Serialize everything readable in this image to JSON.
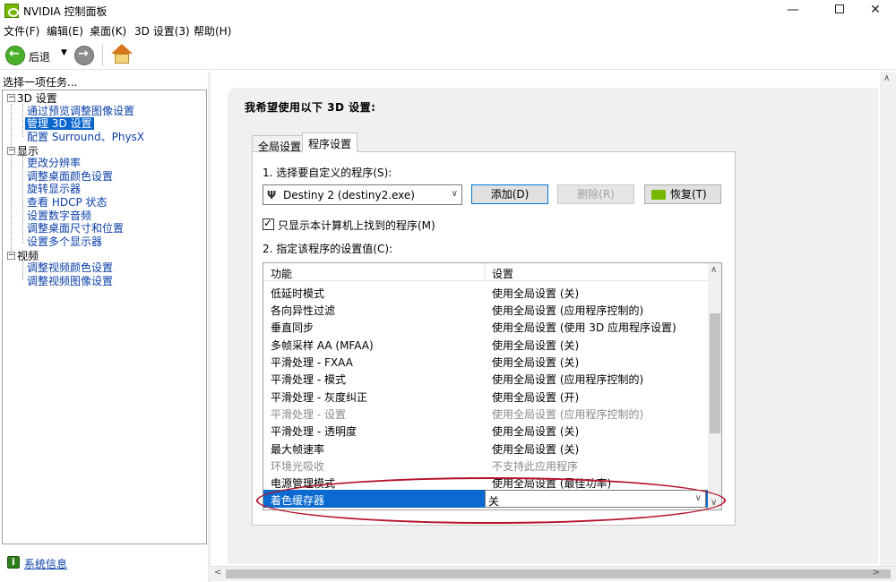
{
  "window": {
    "title": "NVIDIA 控制面板",
    "minimize": "—",
    "close": "✕"
  },
  "menu": [
    "文件(F)",
    "编辑(E)",
    "桌面(K)",
    "3D 设置(3)",
    "帮助(H)"
  ],
  "toolbar": {
    "back_label": "后退"
  },
  "sidebar": {
    "header": "选择一项任务...",
    "groups": [
      {
        "label": "3D 设置",
        "items": [
          "通过预览调整图像设置",
          "管理 3D 设置",
          "配置 Surround、PhysX"
        ]
      },
      {
        "label": "显示",
        "items": [
          "更改分辨率",
          "调整桌面颜色设置",
          "旋转显示器",
          "查看 HDCP 状态",
          "设置数字音频",
          "调整桌面尺寸和位置",
          "设置多个显示器"
        ]
      },
      {
        "label": "视频",
        "items": [
          "调整视频颜色设置",
          "调整视频图像设置"
        ]
      }
    ],
    "selected": "管理 3D 设置",
    "system_info": "系统信息"
  },
  "main": {
    "title": "我希望使用以下 3D 设置:",
    "tabs": [
      "全局设置",
      "程序设置"
    ],
    "active_tab": "程序设置",
    "step1_label": "1. 选择要自定义的程序(S):",
    "program_value": "Destiny 2 (destiny2.exe)",
    "add_button": "添加(D)",
    "remove_button": "删除(R)",
    "restore_button": "恢复(T)",
    "checkbox_label": "只显示本计算机上找到的程序(M)",
    "checkbox_checked": true,
    "step2_label": "2. 指定该程序的设置值(C):",
    "columns": [
      "功能",
      "设置"
    ],
    "rows": [
      {
        "feature": "低延时模式",
        "setting": "使用全局设置 (关)",
        "disabled": false
      },
      {
        "feature": "各向异性过滤",
        "setting": "使用全局设置 (应用程序控制的)",
        "disabled": false
      },
      {
        "feature": "垂直同步",
        "setting": "使用全局设置 (使用 3D 应用程序设置)",
        "disabled": false
      },
      {
        "feature": "多帧采样 AA (MFAA)",
        "setting": "使用全局设置 (关)",
        "disabled": false
      },
      {
        "feature": "平滑处理 - FXAA",
        "setting": "使用全局设置 (关)",
        "disabled": false
      },
      {
        "feature": "平滑处理 - 模式",
        "setting": "使用全局设置 (应用程序控制的)",
        "disabled": false
      },
      {
        "feature": "平滑处理 - 灰度纠正",
        "setting": "使用全局设置 (开)",
        "disabled": false
      },
      {
        "feature": "平滑处理 - 设置",
        "setting": "使用全局设置 (应用程序控制的)",
        "disabled": true
      },
      {
        "feature": "平滑处理 - 透明度",
        "setting": "使用全局设置 (关)",
        "disabled": false
      },
      {
        "feature": "最大帧速率",
        "setting": "使用全局设置 (关)",
        "disabled": false
      },
      {
        "feature": "环境光吸收",
        "setting": "不支持此应用程序",
        "disabled": true
      },
      {
        "feature": "电源管理模式",
        "setting": "使用全局设置 (最佳功率)",
        "disabled": false
      }
    ],
    "selected_row": {
      "feature": "着色缓存器",
      "setting": "关"
    }
  },
  "colors": {
    "nvidia_green": "#76b900",
    "selection_blue": "#0a6ad0",
    "annotation_red": "#b5122a"
  }
}
